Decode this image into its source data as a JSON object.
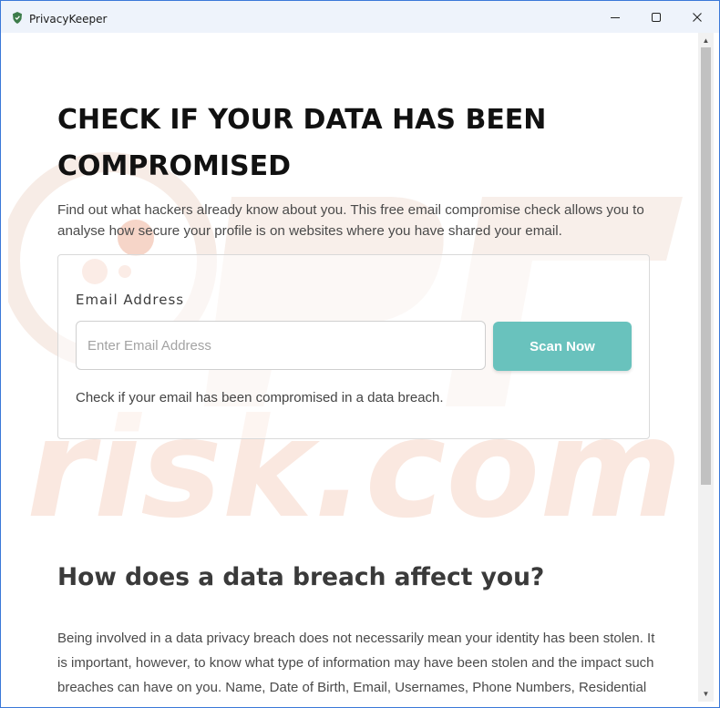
{
  "window": {
    "title": "PrivacyKeeper",
    "controls": {
      "minimize_icon": "minimize-icon",
      "maximize_icon": "maximize-icon",
      "close_icon": "close-icon"
    }
  },
  "hero": {
    "title": "CHECK IF YOUR DATA HAS BEEN COMPROMISED",
    "description": "Find out what hackers already know about you. This free email compromise check allows you to analyse how secure your profile is on websites where you have shared your email."
  },
  "form": {
    "label": "Email Address",
    "input_value": "",
    "input_placeholder": "Enter Email Address",
    "button_label": "Scan Now",
    "note": "Check if your email has been compromised in a data breach."
  },
  "section": {
    "title": "How does a data breach affect you?",
    "body": "Being involved in a data privacy breach does not necessarily mean your identity has been stolen. It is important, however, to know what type of information may have been stolen and the impact such breaches can have on you. Name, Date of Birth, Email, Usernames, Phone Numbers, Residential"
  },
  "colors": {
    "accent": "#69c2bd",
    "window_border": "#3b78d8",
    "titlebar": "#eef3fb",
    "watermark": "#f9e1d6"
  },
  "watermark_text": "risk.com"
}
